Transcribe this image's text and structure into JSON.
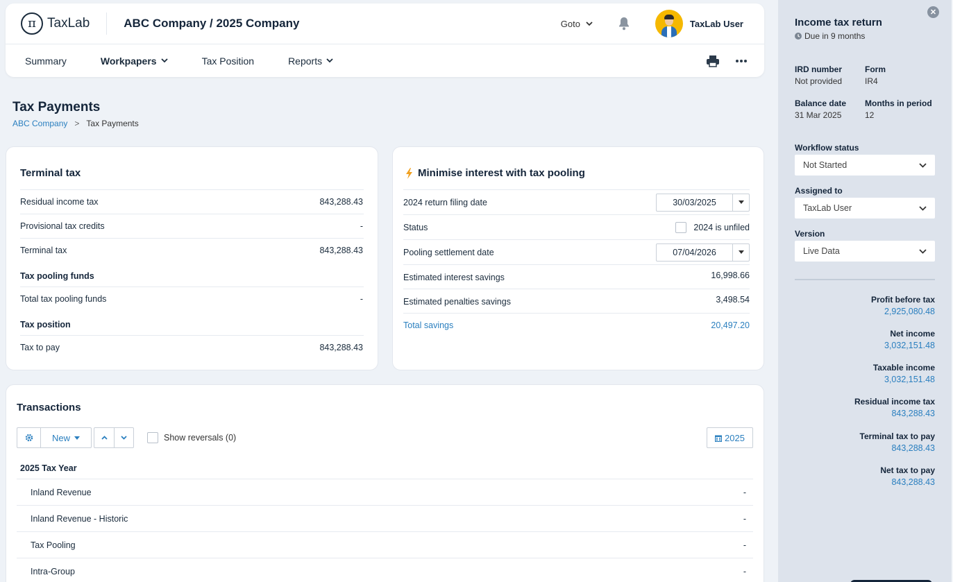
{
  "header": {
    "logo_text": "TaxLab",
    "company": "ABC Company / 2025 Company",
    "goto_label": "Goto",
    "user_name": "TaxLab User"
  },
  "nav": {
    "items": [
      {
        "label": "Summary"
      },
      {
        "label": "Workpapers"
      },
      {
        "label": "Tax Position"
      },
      {
        "label": "Reports"
      }
    ]
  },
  "page": {
    "title": "Tax Payments",
    "breadcrumb": {
      "root": "ABC Company",
      "separator": ">",
      "current": "Tax Payments"
    }
  },
  "terminal": {
    "title": "Terminal tax",
    "rows": [
      {
        "label": "Residual income tax",
        "value": "843,288.43"
      },
      {
        "label": "Provisional tax credits",
        "value": "-"
      },
      {
        "label": "Terminal tax",
        "value": "843,288.43"
      }
    ],
    "pooling_title": "Tax pooling funds",
    "pooling_rows": [
      {
        "label": "Total tax pooling funds",
        "value": "-"
      }
    ],
    "position_title": "Tax position",
    "position_rows": [
      {
        "label": "Tax to pay",
        "value": "843,288.43"
      }
    ]
  },
  "pooling": {
    "title": "Minimise interest with tax pooling",
    "filing_label": "2024 return filing date",
    "filing_date": "30/03/2025",
    "status_label": "Status",
    "status_check_label": "2024 is unfiled",
    "settlement_label": "Pooling settlement date",
    "settlement_date": "07/04/2026",
    "interest_label": "Estimated interest savings",
    "interest_value": "16,998.66",
    "penalties_label": "Estimated penalties savings",
    "penalties_value": "3,498.54",
    "total_label": "Total savings",
    "total_value": "20,497.20"
  },
  "transactions": {
    "title": "Transactions",
    "new_label": "New",
    "show_reversals": "Show reversals (0)",
    "year_button": "2025",
    "group_title": "2025 Tax Year",
    "rows": [
      {
        "label": "Inland Revenue",
        "value": "-"
      },
      {
        "label": "Inland Revenue - Historic",
        "value": "-"
      },
      {
        "label": "Tax Pooling",
        "value": "-"
      },
      {
        "label": "Intra-Group",
        "value": "-"
      }
    ]
  },
  "side": {
    "title": "Income tax return",
    "due": "Due in 9 months",
    "ird_label": "IRD number",
    "ird_value": "Not provided",
    "form_label": "Form",
    "form_value": "IR4",
    "balance_label": "Balance date",
    "balance_value": "31 Mar 2025",
    "months_label": "Months in period",
    "months_value": "12",
    "workflow_label": "Workflow status",
    "workflow_value": "Not Started",
    "assigned_label": "Assigned to",
    "assigned_value": "TaxLab User",
    "version_label": "Version",
    "version_value": "Live Data",
    "metrics": [
      {
        "label": "Profit before tax",
        "value": "2,925,080.48"
      },
      {
        "label": "Net income",
        "value": "3,032,151.48"
      },
      {
        "label": "Taxable income",
        "value": "3,032,151.48"
      },
      {
        "label": "Residual income tax",
        "value": "843,288.43"
      },
      {
        "label": "Terminal tax to pay",
        "value": "843,288.43"
      },
      {
        "label": "Net tax to pay",
        "value": "843,288.43"
      }
    ]
  },
  "colors": {
    "accent": "#2a7fbf",
    "panel_bg": "#dde3ec",
    "page_bg": "#eef2f7",
    "avatar_bg": "#f5b800"
  }
}
